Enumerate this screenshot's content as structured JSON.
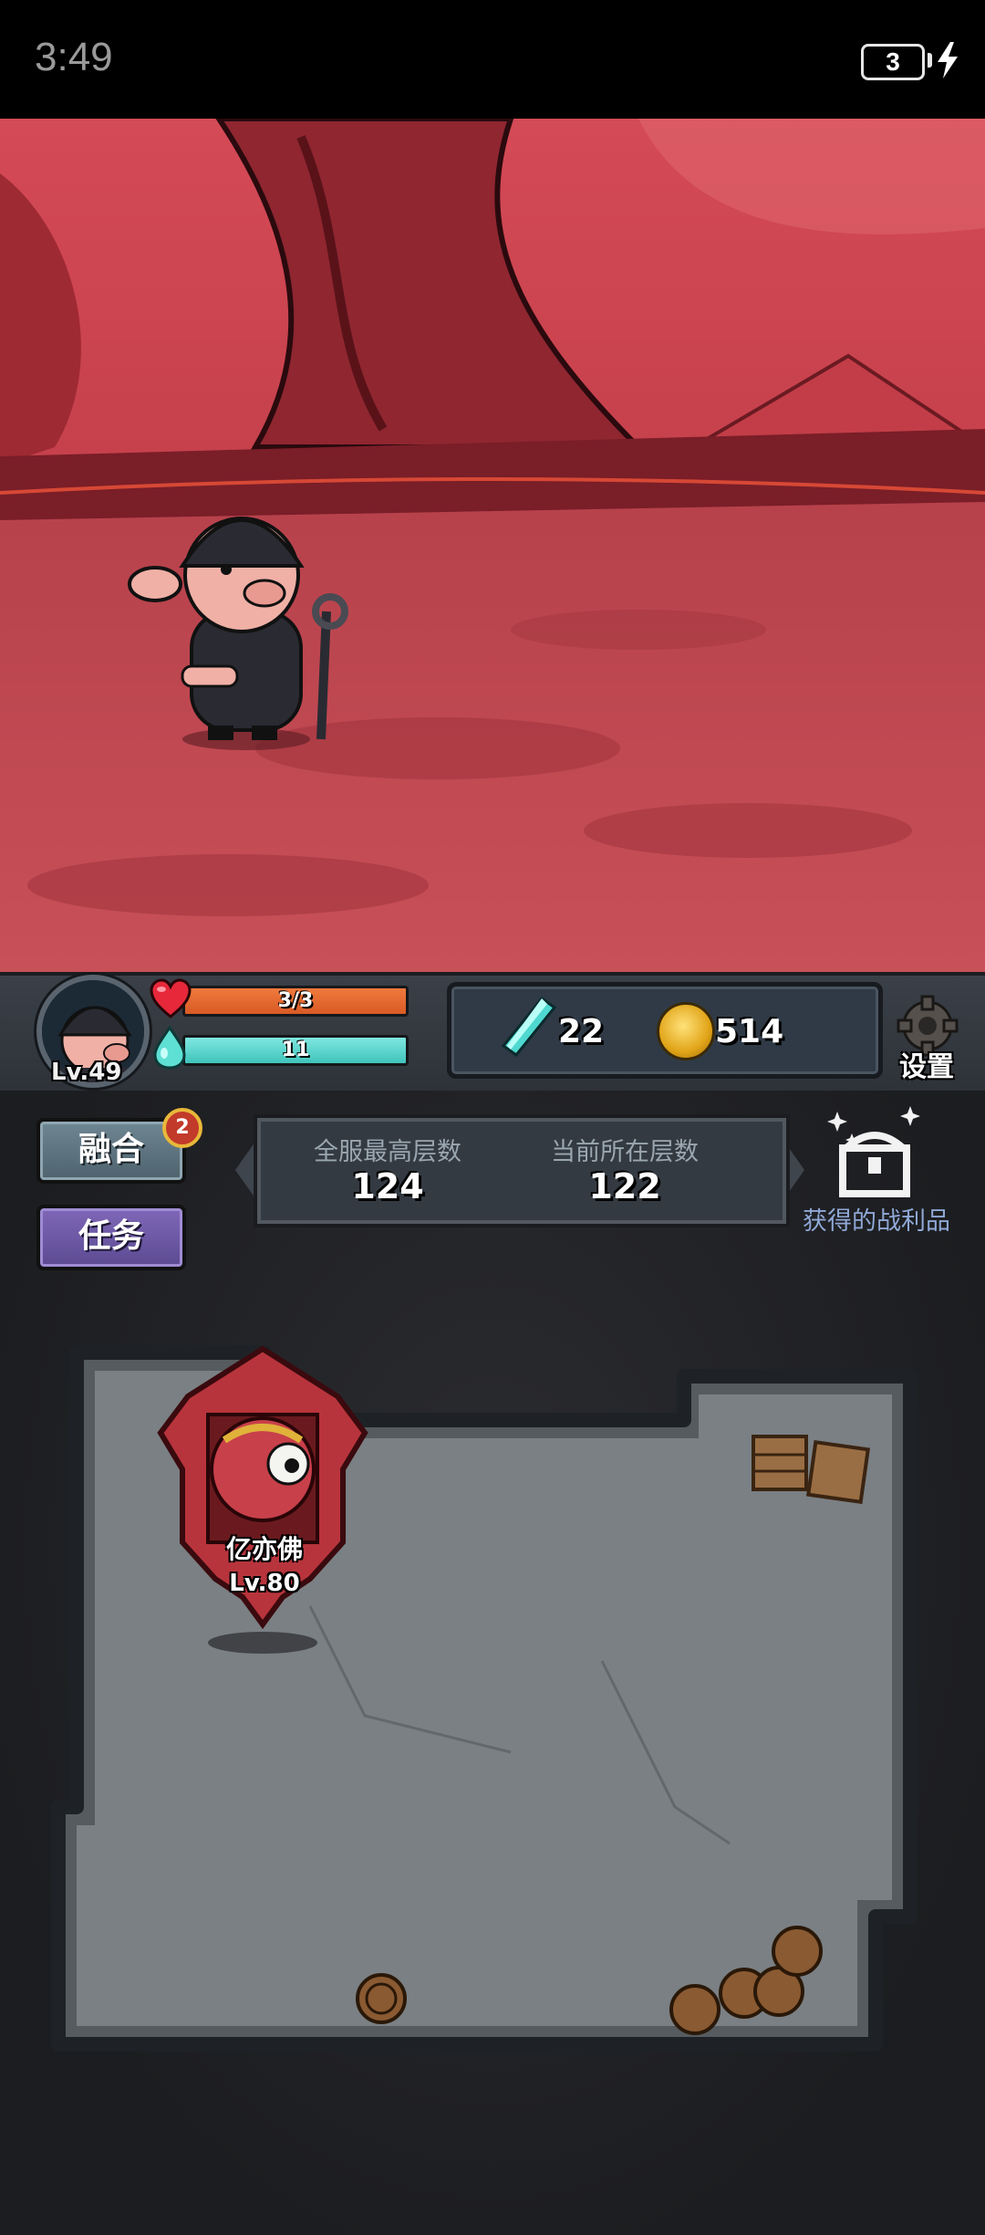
{
  "status_bar": {
    "time": "3:49",
    "battery_level": "3",
    "charging_icon": "lightning-bolt-icon"
  },
  "player": {
    "level_label": "Lv.49",
    "hp_text": "3/3",
    "hp_fraction": 1.0,
    "mp_text": "11",
    "mp_fraction": 1.0,
    "hp_icon": "heart-icon",
    "mp_icon": "drop-icon"
  },
  "resources": {
    "crystal": "22",
    "coin": "514"
  },
  "settings": {
    "label": "设置",
    "icon": "gear-icon"
  },
  "menu": {
    "fusion_label": "融合",
    "fusion_badge": "2",
    "task_label": "任务"
  },
  "floors": {
    "max_label": "全服最高层数",
    "max_value": "124",
    "current_label": "当前所在层数",
    "current_value": "122"
  },
  "loot": {
    "label": "获得的战利品",
    "icon": "treasure-chest-icon"
  },
  "boss": {
    "name": "亿亦佛",
    "level": "Lv.80"
  },
  "colors": {
    "hp": "#e56a30",
    "mp": "#4fd0c6",
    "fusion_button": "#5a707c",
    "task_button": "#6a57a6",
    "scene": "#b8343c"
  }
}
